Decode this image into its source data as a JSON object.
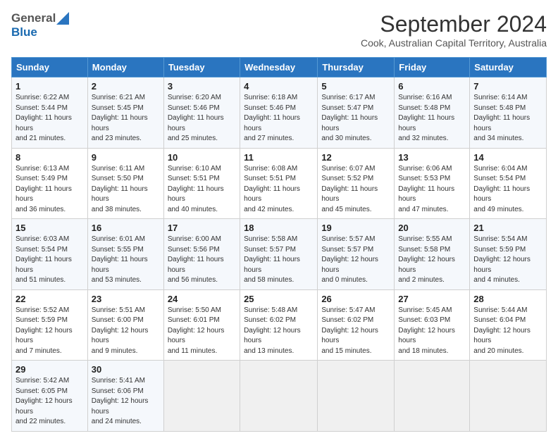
{
  "header": {
    "logo_general": "General",
    "logo_blue": "Blue",
    "month_title": "September 2024",
    "subtitle": "Cook, Australian Capital Territory, Australia"
  },
  "days_of_week": [
    "Sunday",
    "Monday",
    "Tuesday",
    "Wednesday",
    "Thursday",
    "Friday",
    "Saturday"
  ],
  "weeks": [
    [
      {
        "day": "1",
        "sunrise": "6:22 AM",
        "sunset": "5:44 PM",
        "daylight": "11 hours and 21 minutes."
      },
      {
        "day": "2",
        "sunrise": "6:21 AM",
        "sunset": "5:45 PM",
        "daylight": "11 hours and 23 minutes."
      },
      {
        "day": "3",
        "sunrise": "6:20 AM",
        "sunset": "5:46 PM",
        "daylight": "11 hours and 25 minutes."
      },
      {
        "day": "4",
        "sunrise": "6:18 AM",
        "sunset": "5:46 PM",
        "daylight": "11 hours and 27 minutes."
      },
      {
        "day": "5",
        "sunrise": "6:17 AM",
        "sunset": "5:47 PM",
        "daylight": "11 hours and 30 minutes."
      },
      {
        "day": "6",
        "sunrise": "6:16 AM",
        "sunset": "5:48 PM",
        "daylight": "11 hours and 32 minutes."
      },
      {
        "day": "7",
        "sunrise": "6:14 AM",
        "sunset": "5:48 PM",
        "daylight": "11 hours and 34 minutes."
      }
    ],
    [
      {
        "day": "8",
        "sunrise": "6:13 AM",
        "sunset": "5:49 PM",
        "daylight": "11 hours and 36 minutes."
      },
      {
        "day": "9",
        "sunrise": "6:11 AM",
        "sunset": "5:50 PM",
        "daylight": "11 hours and 38 minutes."
      },
      {
        "day": "10",
        "sunrise": "6:10 AM",
        "sunset": "5:51 PM",
        "daylight": "11 hours and 40 minutes."
      },
      {
        "day": "11",
        "sunrise": "6:08 AM",
        "sunset": "5:51 PM",
        "daylight": "11 hours and 42 minutes."
      },
      {
        "day": "12",
        "sunrise": "6:07 AM",
        "sunset": "5:52 PM",
        "daylight": "11 hours and 45 minutes."
      },
      {
        "day": "13",
        "sunrise": "6:06 AM",
        "sunset": "5:53 PM",
        "daylight": "11 hours and 47 minutes."
      },
      {
        "day": "14",
        "sunrise": "6:04 AM",
        "sunset": "5:54 PM",
        "daylight": "11 hours and 49 minutes."
      }
    ],
    [
      {
        "day": "15",
        "sunrise": "6:03 AM",
        "sunset": "5:54 PM",
        "daylight": "11 hours and 51 minutes."
      },
      {
        "day": "16",
        "sunrise": "6:01 AM",
        "sunset": "5:55 PM",
        "daylight": "11 hours and 53 minutes."
      },
      {
        "day": "17",
        "sunrise": "6:00 AM",
        "sunset": "5:56 PM",
        "daylight": "11 hours and 56 minutes."
      },
      {
        "day": "18",
        "sunrise": "5:58 AM",
        "sunset": "5:57 PM",
        "daylight": "11 hours and 58 minutes."
      },
      {
        "day": "19",
        "sunrise": "5:57 AM",
        "sunset": "5:57 PM",
        "daylight": "12 hours and 0 minutes."
      },
      {
        "day": "20",
        "sunrise": "5:55 AM",
        "sunset": "5:58 PM",
        "daylight": "12 hours and 2 minutes."
      },
      {
        "day": "21",
        "sunrise": "5:54 AM",
        "sunset": "5:59 PM",
        "daylight": "12 hours and 4 minutes."
      }
    ],
    [
      {
        "day": "22",
        "sunrise": "5:52 AM",
        "sunset": "5:59 PM",
        "daylight": "12 hours and 7 minutes."
      },
      {
        "day": "23",
        "sunrise": "5:51 AM",
        "sunset": "6:00 PM",
        "daylight": "12 hours and 9 minutes."
      },
      {
        "day": "24",
        "sunrise": "5:50 AM",
        "sunset": "6:01 PM",
        "daylight": "12 hours and 11 minutes."
      },
      {
        "day": "25",
        "sunrise": "5:48 AM",
        "sunset": "6:02 PM",
        "daylight": "12 hours and 13 minutes."
      },
      {
        "day": "26",
        "sunrise": "5:47 AM",
        "sunset": "6:02 PM",
        "daylight": "12 hours and 15 minutes."
      },
      {
        "day": "27",
        "sunrise": "5:45 AM",
        "sunset": "6:03 PM",
        "daylight": "12 hours and 18 minutes."
      },
      {
        "day": "28",
        "sunrise": "5:44 AM",
        "sunset": "6:04 PM",
        "daylight": "12 hours and 20 minutes."
      }
    ],
    [
      {
        "day": "29",
        "sunrise": "5:42 AM",
        "sunset": "6:05 PM",
        "daylight": "12 hours and 22 minutes."
      },
      {
        "day": "30",
        "sunrise": "5:41 AM",
        "sunset": "6:06 PM",
        "daylight": "12 hours and 24 minutes."
      },
      null,
      null,
      null,
      null,
      null
    ]
  ],
  "labels": {
    "sunrise": "Sunrise: ",
    "sunset": "Sunset: ",
    "daylight": "Daylight: "
  }
}
